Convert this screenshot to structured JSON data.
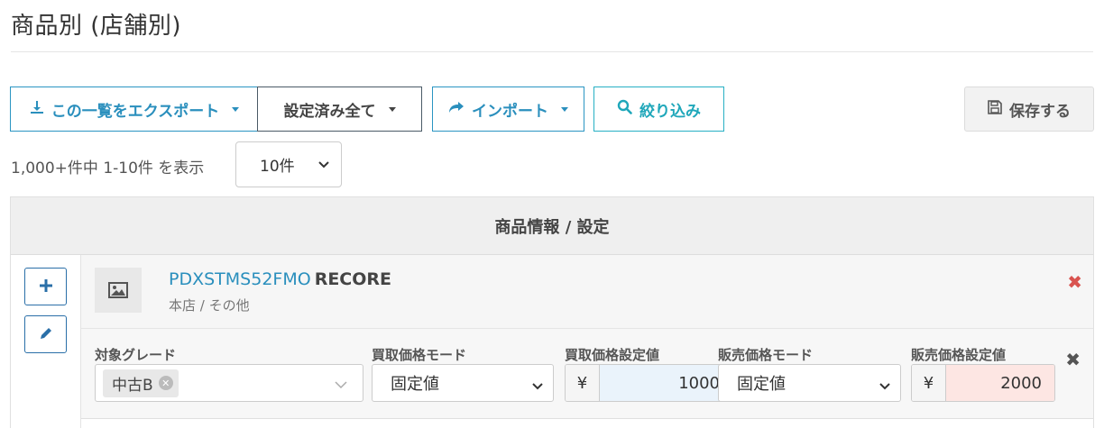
{
  "page": {
    "title": "商品別 (店舗別)"
  },
  "toolbar": {
    "export_label": "この一覧をエクスポート",
    "setall_label": "設定済み全て",
    "import_label": "インポート",
    "filter_label": "絞り込み",
    "save_label": "保存する"
  },
  "pagination": {
    "summary": "1,000+件中 1-10件 を表示",
    "page_size": "10件"
  },
  "table": {
    "header": "商品情報 / 設定",
    "rows": [
      {
        "sku": "PDXSTMS52FMO",
        "brand": "RECORE",
        "store_path": "本店 / その他",
        "settings": {
          "grade_label": "対象グレード",
          "grade_chip": "中古B",
          "buy_mode_label": "買取価格モード",
          "buy_mode_value": "固定値",
          "buy_price_label": "買取価格設定値",
          "buy_currency": "¥",
          "buy_price_value": "1000",
          "sell_mode_label": "販売価格モード",
          "sell_mode_value": "固定値",
          "sell_price_label": "販売価格設定値",
          "sell_currency": "¥",
          "sell_price_value": "2000"
        }
      }
    ]
  },
  "colors": {
    "primary": "#2a8fbd",
    "info": "#1fa7ba",
    "danger": "#d9534f",
    "buy_value_bg": "#eaf3fb",
    "sell_value_bg": "#fde6e3"
  },
  "icons": [
    "download-icon",
    "share-icon",
    "search-icon",
    "save-icon",
    "plus-icon",
    "pencil-icon",
    "image-icon",
    "close-icon",
    "chevron-down-icon"
  ]
}
